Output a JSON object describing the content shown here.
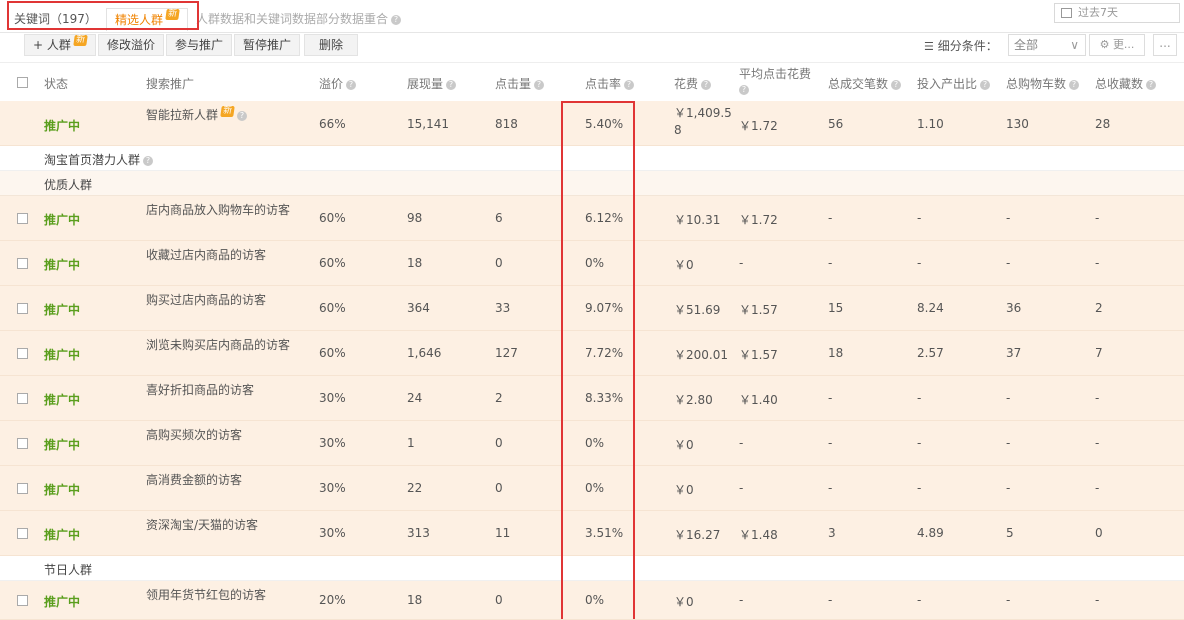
{
  "tabs": {
    "keywords_label": "关键词（197）",
    "crowd_label": "精选人群",
    "crowd_badge": "新",
    "note": "人群数据和关键词数据部分数据重合"
  },
  "date_range": "过去7天",
  "toolbar": {
    "add_crowd": "+ 人群",
    "add_crowd_badge": "新",
    "modify_premium": "修改溢价",
    "join_promo": "参与推广",
    "pause_promo": "暂停推广",
    "delete": "删除",
    "filter_label": "细分条件：",
    "filter_value": "全部",
    "more": "更...",
    "dots": "..."
  },
  "columns": {
    "status": "状态",
    "search": "搜索推广",
    "premium": "溢价",
    "impressions": "展现量",
    "clicks": "点击量",
    "ctr": "点击率",
    "cost": "花费",
    "avg_cpc": "平均点击花费",
    "total_orders": "总成交笔数",
    "roi": "投入产出比",
    "total_cart": "总购物车数",
    "total_fav": "总收藏数"
  },
  "smart_row": {
    "status": "推广中",
    "name": "智能拉新人群",
    "badge": "新",
    "premium": "66%",
    "impressions": "15,141",
    "clicks": "818",
    "ctr": "5.40%",
    "cost_line1": "￥1,409.5",
    "cost_line2": "8",
    "avg_cpc": "￥1.72",
    "orders": "56",
    "roi": "1.10",
    "cart": "130",
    "fav": "28"
  },
  "groups": {
    "homepage": "淘宝首页潜力人群",
    "quality": "优质人群",
    "holiday": "节日人群"
  },
  "rows": [
    {
      "status": "推广中",
      "name": "店内商品放入购物车的访客",
      "premium": "60%",
      "impressions": "98",
      "clicks": "6",
      "ctr": "6.12%",
      "cost": "￥10.31",
      "avg_cpc": "￥1.72",
      "orders": "-",
      "roi": "-",
      "cart": "-",
      "fav": "-"
    },
    {
      "status": "推广中",
      "name": "收藏过店内商品的访客",
      "premium": "60%",
      "impressions": "18",
      "clicks": "0",
      "ctr": "0%",
      "cost": "￥0",
      "avg_cpc": "-",
      "orders": "-",
      "roi": "-",
      "cart": "-",
      "fav": "-"
    },
    {
      "status": "推广中",
      "name": "购买过店内商品的访客",
      "premium": "60%",
      "impressions": "364",
      "clicks": "33",
      "ctr": "9.07%",
      "cost": "￥51.69",
      "avg_cpc": "￥1.57",
      "orders": "15",
      "roi": "8.24",
      "cart": "36",
      "fav": "2"
    },
    {
      "status": "推广中",
      "name": "浏览未购买店内商品的访客",
      "premium": "60%",
      "impressions": "1,646",
      "clicks": "127",
      "ctr": "7.72%",
      "cost": "￥200.01",
      "avg_cpc": "￥1.57",
      "orders": "18",
      "roi": "2.57",
      "cart": "37",
      "fav": "7"
    },
    {
      "status": "推广中",
      "name": "喜好折扣商品的访客",
      "premium": "30%",
      "impressions": "24",
      "clicks": "2",
      "ctr": "8.33%",
      "cost": "￥2.80",
      "avg_cpc": "￥1.40",
      "orders": "-",
      "roi": "-",
      "cart": "-",
      "fav": "-"
    },
    {
      "status": "推广中",
      "name": "高购买频次的访客",
      "premium": "30%",
      "impressions": "1",
      "clicks": "0",
      "ctr": "0%",
      "cost": "￥0",
      "avg_cpc": "-",
      "orders": "-",
      "roi": "-",
      "cart": "-",
      "fav": "-"
    },
    {
      "status": "推广中",
      "name": "高消费金额的访客",
      "premium": "30%",
      "impressions": "22",
      "clicks": "0",
      "ctr": "0%",
      "cost": "￥0",
      "avg_cpc": "-",
      "orders": "-",
      "roi": "-",
      "cart": "-",
      "fav": "-"
    },
    {
      "status": "推广中",
      "name": "资深淘宝/天猫的访客",
      "premium": "30%",
      "impressions": "313",
      "clicks": "11",
      "ctr": "3.51%",
      "cost": "￥16.27",
      "avg_cpc": "￥1.48",
      "orders": "3",
      "roi": "4.89",
      "cart": "5",
      "fav": "0"
    }
  ],
  "holiday_row": {
    "status": "推广中",
    "name": "领用年货节红包的访客",
    "premium": "20%",
    "impressions": "18",
    "clicks": "0",
    "ctr": "0%",
    "cost": "￥0",
    "avg_cpc": "-",
    "orders": "-",
    "roi": "-",
    "cart": "-",
    "fav": "-"
  },
  "colors": {
    "accent": "#f08300",
    "status_green": "#5a9e1d",
    "row_bg": "#fdf0e3",
    "highlight": "#e03535"
  }
}
